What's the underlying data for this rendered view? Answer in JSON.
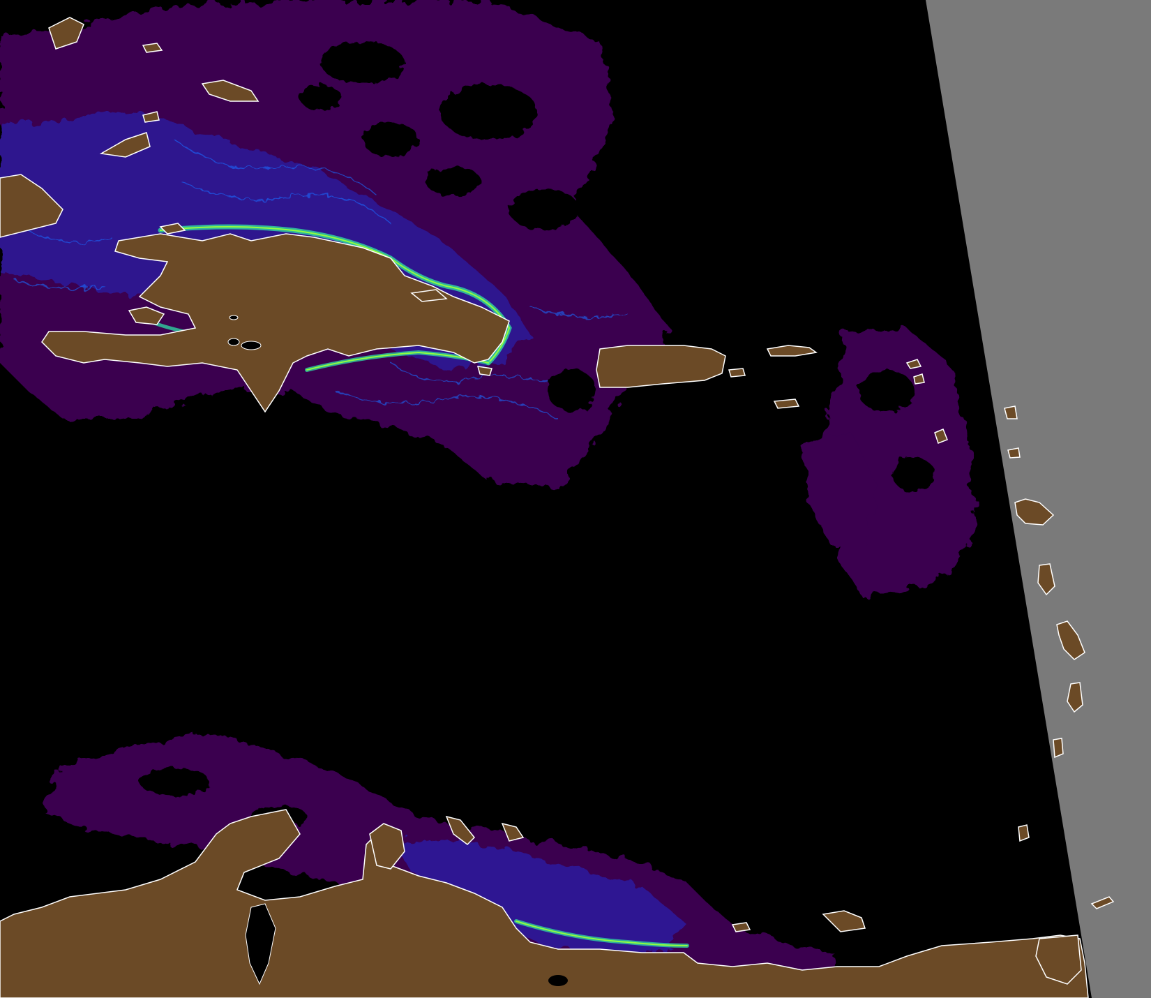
{
  "map": {
    "colors": {
      "ocean_no_data": "#000000",
      "outside_swath": "#7a7a7a",
      "land": "#6b4a26",
      "coastline": "#ffffff",
      "chlorophyll_low": "#3a0050",
      "chlorophyll_mid": "#2a1aa8",
      "chlorophyll_high": "#1a6cff",
      "chlorophyll_peak": "#30d0a0",
      "chlorophyll_max": "#90ff40"
    },
    "regions": [
      "hispaniola",
      "puerto-rico",
      "cuba-east",
      "jamaica",
      "south-american-coast",
      "lesser-antilles"
    ]
  }
}
